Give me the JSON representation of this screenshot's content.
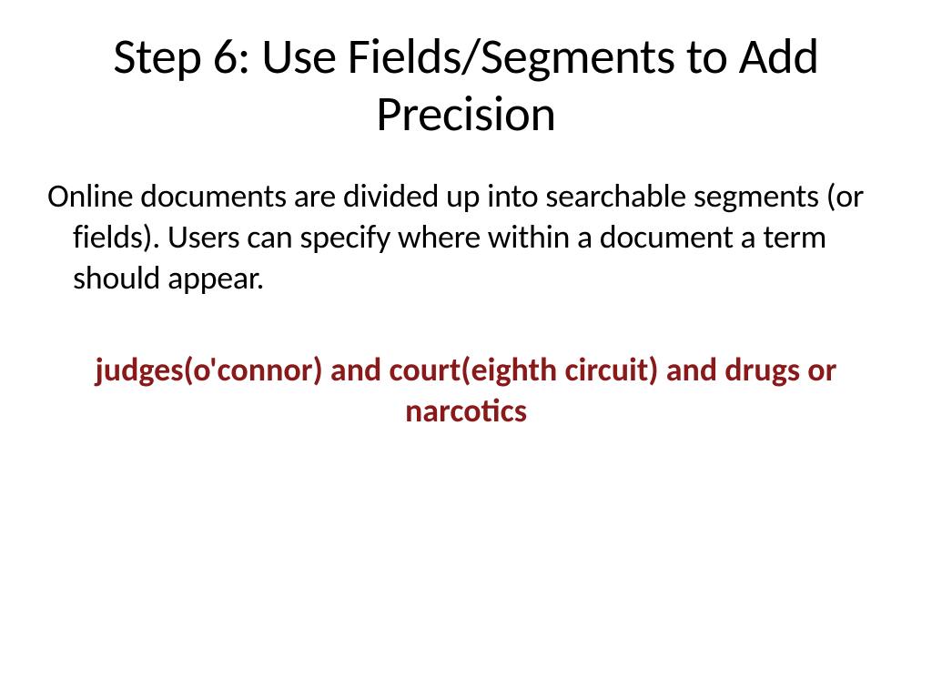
{
  "title": "Step 6: Use Fields/Segments to Add Precision",
  "body": "Online documents are divided up into searchable segments (or fields). Users can specify where within a document a term should appear.",
  "example": "judges(o'connor) and court(eighth circuit) and drugs or narcotics",
  "colors": {
    "example_text": "#8a1a1a",
    "body_text": "#000000",
    "background": "#ffffff"
  }
}
